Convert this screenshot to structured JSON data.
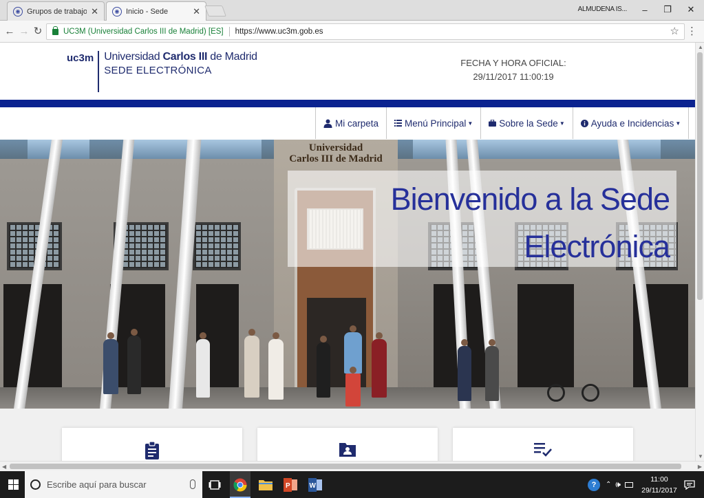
{
  "browser": {
    "tabs": [
      {
        "label": "Grupos de trabajo / Con",
        "active": false
      },
      {
        "label": "Inicio - Sede",
        "active": true
      }
    ],
    "user_name": "ALMUDENA IS...",
    "window_controls": {
      "minimize": "–",
      "maximize": "❐",
      "close": "✕"
    },
    "address": {
      "site_identity": "UC3M (Universidad Carlos III de Madrid) [ES]",
      "url": "https://www.uc3m.gob.es"
    }
  },
  "header": {
    "logo_mark": "uc3m",
    "logo_line1_pre": "Universidad ",
    "logo_line1_bold": "Carlos III",
    "logo_line1_post": " de Madrid",
    "logo_line2": "SEDE ELECTRÓNICA",
    "clock_label": "FECHA Y HORA OFICIAL:",
    "clock_value": "29/11/2017  11:00:19"
  },
  "nav": {
    "items": [
      {
        "label": "Mi carpeta",
        "icon": "user-icon",
        "caret": false
      },
      {
        "label": "Menú Principal",
        "icon": "list-icon",
        "caret": true
      },
      {
        "label": "Sobre la Sede",
        "icon": "briefcase-icon",
        "caret": true
      },
      {
        "label": "Ayuda e Incidencias",
        "icon": "info-icon",
        "caret": true
      }
    ]
  },
  "hero": {
    "building_sign_line1": "Universidad",
    "building_sign_line2": "Carlos III de Madrid",
    "title_line1": "Bienvenido a la Sede",
    "title_line2": "Electrónica"
  },
  "cards": [
    {
      "icon": "clipboard-icon"
    },
    {
      "icon": "id-folder-icon"
    },
    {
      "icon": "checklist-icon"
    }
  ],
  "taskbar": {
    "search_placeholder": "Escribe aquí para buscar",
    "time": "11:00",
    "date": "29/11/2017"
  },
  "colors": {
    "brand_navy": "#1f2b6e",
    "band_blue": "#0b2390",
    "secure_green": "#188038"
  }
}
